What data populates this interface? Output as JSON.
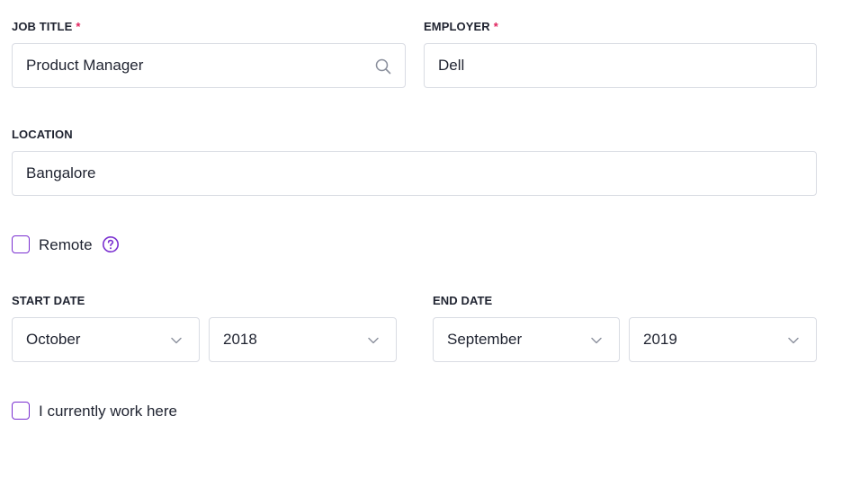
{
  "form": {
    "job_title": {
      "label": "JOB TITLE",
      "required": "*",
      "value": "Product Manager",
      "icon": "search-icon"
    },
    "employer": {
      "label": "EMPLOYER",
      "required": "*",
      "value": "Dell"
    },
    "location": {
      "label": "LOCATION",
      "value": "Bangalore"
    },
    "remote": {
      "label": "Remote",
      "checked": false,
      "help_icon": "question-circle-icon"
    },
    "start_date": {
      "label": "START DATE",
      "month": "October",
      "year": "2018"
    },
    "end_date": {
      "label": "END DATE",
      "month": "September",
      "year": "2019"
    },
    "current": {
      "label": "I currently work here",
      "checked": false
    }
  },
  "colors": {
    "accent": "#7a2fd0",
    "required": "#e0245e",
    "border": "#d9dce3",
    "icon_gray": "#8a8f9c"
  }
}
